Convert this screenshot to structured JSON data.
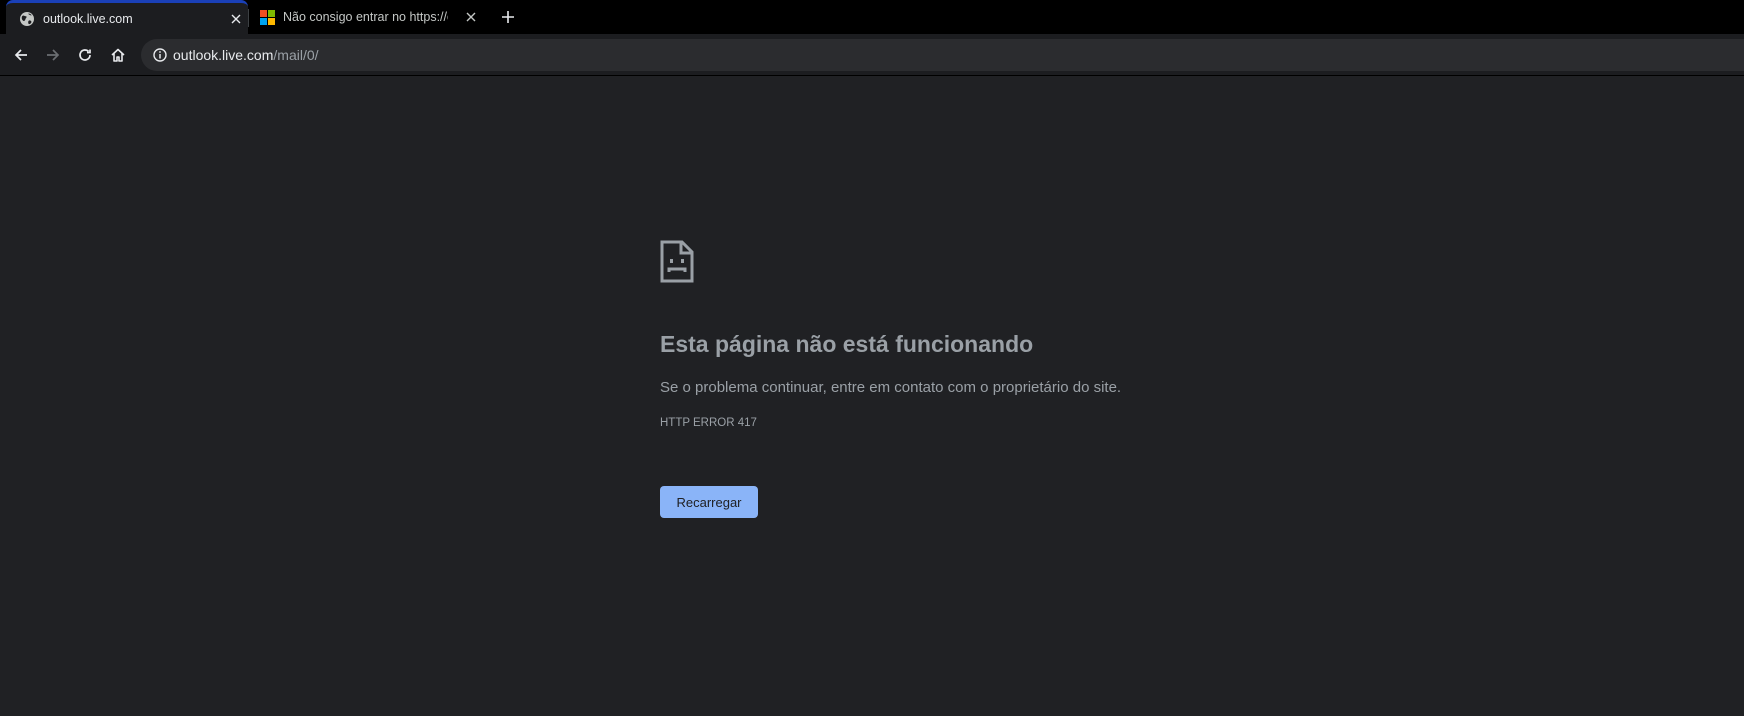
{
  "tabs": [
    {
      "title": "outlook.live.com",
      "favicon": "globe-icon",
      "active": true
    },
    {
      "title": "Não consigo entrar no https://ou",
      "favicon": "microsoft-logo-icon",
      "active": false
    }
  ],
  "toolbar": {
    "url_host": "outlook.live.com",
    "url_path": "/mail/0/"
  },
  "error": {
    "icon": "sad-page-icon",
    "title": "Esta página não está funcionando",
    "description": "Se o problema continuar, entre em contato com o proprietário do site.",
    "code": "HTTP ERROR 417",
    "reload_label": "Recarregar"
  },
  "colors": {
    "background": "#202124",
    "button": "#8ab4f8",
    "text_muted": "#9aa0a6",
    "active_tab_accent": "#1a40b8"
  }
}
